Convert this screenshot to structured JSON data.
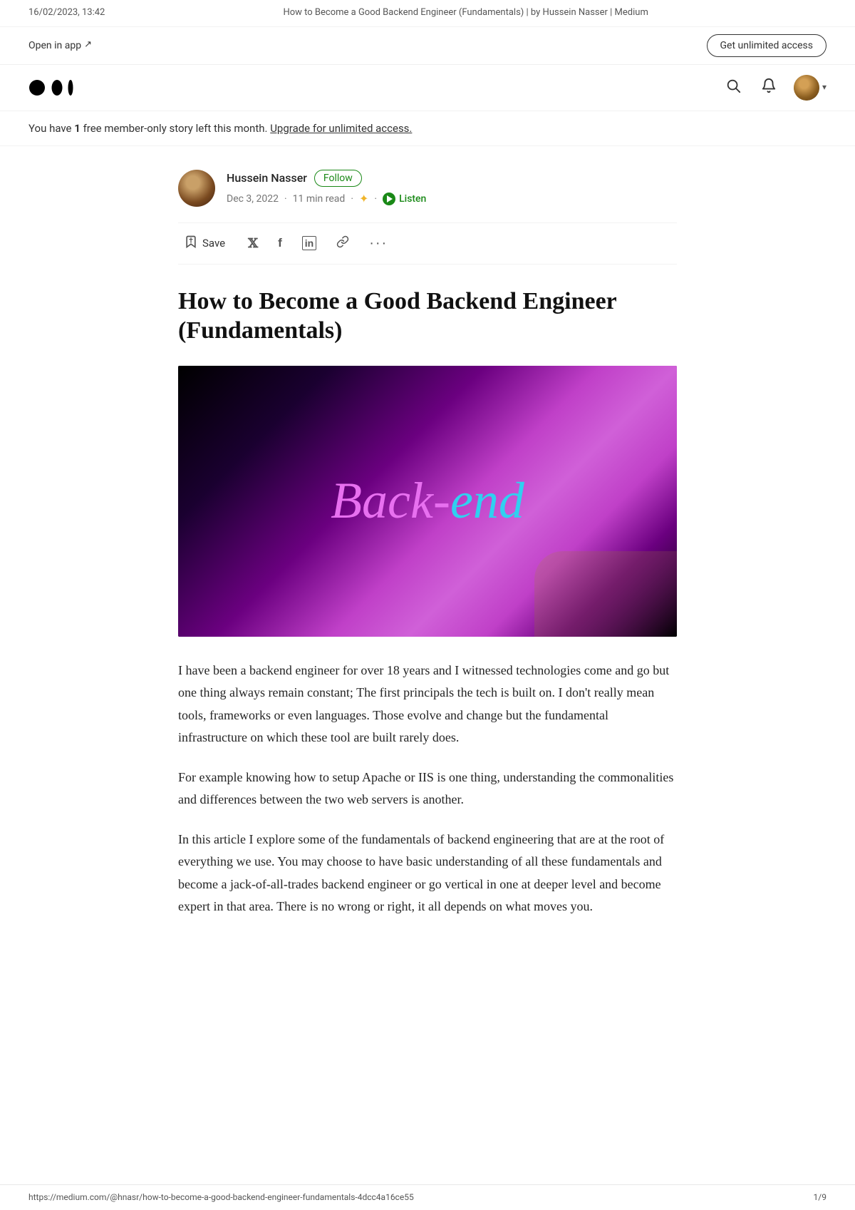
{
  "browser": {
    "timestamp": "16/02/2023, 13:42",
    "title": "How to Become a Good Backend Engineer (Fundamentals) | by Hussein Nasser | Medium",
    "url": "https://medium.com/@hnasr/how-to-become-a-good-backend-engineer-fundamentals-4dcc4a16ce55",
    "page": "1/9"
  },
  "topbar": {
    "open_in_app": "Open in app",
    "arrow": "↗",
    "get_unlimited": "Get unlimited access"
  },
  "membership": {
    "text_prefix": "You have ",
    "count": "1",
    "text_suffix": " free member-only story left this month.",
    "upgrade_link": "Upgrade for unlimited access."
  },
  "author": {
    "name": "Hussein Nasser",
    "follow_label": "Follow",
    "date": "Dec 3, 2022",
    "read_time": "11 min read",
    "listen_label": "Listen"
  },
  "toolbar": {
    "save_label": "Save",
    "more_label": "···"
  },
  "article": {
    "title": "How to Become a Good Backend Engineer (Fundamentals)",
    "hero_back": "Back-",
    "hero_end": "end",
    "body": [
      "I have been a backend engineer for over 18 years and I witnessed technologies come and go but one thing always remain constant; The first principals the tech is built on. I don't really mean tools, frameworks or even languages. Those evolve and change but the fundamental infrastructure on which these tool are built rarely does.",
      "For example knowing how to setup Apache or IIS is one thing, understanding the commonalities and differences between the two web servers is another.",
      "In this article I explore some of the fundamentals of backend engineering that are at the root of everything we use. You may choose to have basic understanding of all these fundamentals and become a jack-of-all-trades backend engineer or go vertical in one at deeper level and become expert in that area. There is no wrong or right, it all depends on what moves you."
    ]
  },
  "icons": {
    "search": "🔍",
    "bell": "🔔",
    "bookmark": "🔖",
    "twitter": "𝕏",
    "facebook": "f",
    "linkedin": "in",
    "link": "🔗",
    "chevron_down": "▾"
  }
}
